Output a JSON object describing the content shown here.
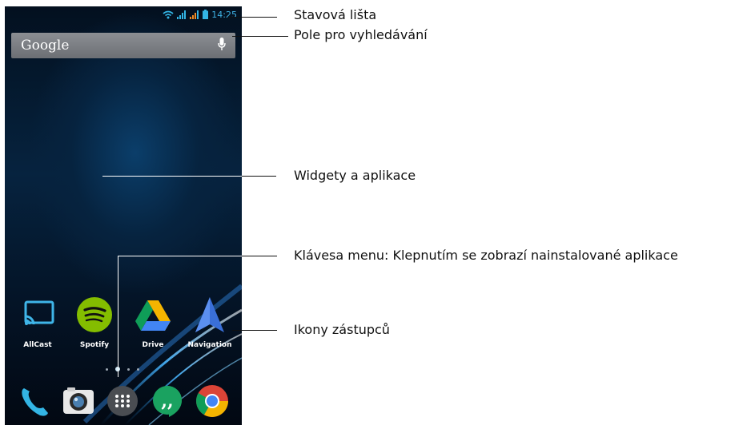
{
  "status_bar": {
    "time": "14:25",
    "icons": [
      "wifi-icon",
      "signal-icon",
      "signal-icon",
      "battery-icon"
    ]
  },
  "search": {
    "logo": "Google",
    "icon": "mic-icon"
  },
  "shortcuts": [
    {
      "label": "AllCast",
      "icon": "cast-icon"
    },
    {
      "label": "Spotify",
      "icon": "spotify-icon"
    },
    {
      "label": "Drive",
      "icon": "drive-icon"
    },
    {
      "label": "Navigation",
      "icon": "navigation-icon"
    }
  ],
  "dock": [
    "phone-icon",
    "camera-icon",
    "app-drawer-icon",
    "hangouts-icon",
    "chrome-icon"
  ],
  "callouts": {
    "status_bar": "Stavová lišta",
    "search": "Pole pro vyhledávání",
    "widgets": "Widgety a aplikace",
    "menu_key": "Klávesa menu: Klepnutím se zobrazí nainstalované aplikace",
    "shortcuts": "Ikony zástupců"
  },
  "colors": {
    "accent": "#33b5e5",
    "wallpaper": "#06233f"
  }
}
